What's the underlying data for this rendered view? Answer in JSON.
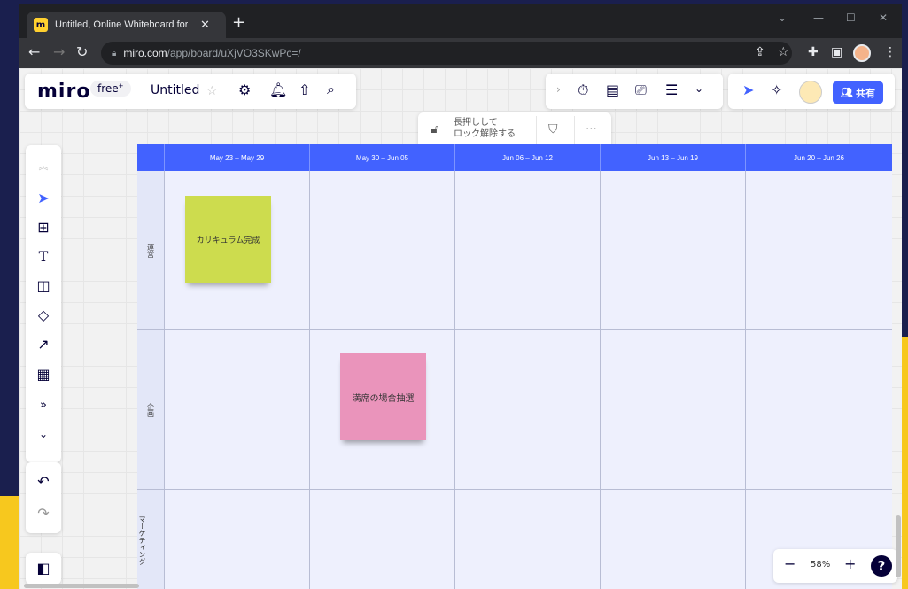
{
  "browser": {
    "tab_title": "Untitled, Online Whiteboard for Visual Collaboration",
    "url_host": "miro.com",
    "url_path": "/app/board/uXjVO3SKwPc=/"
  },
  "app": {
    "logo": "miro",
    "plan": "free",
    "plan_sup": "+",
    "board_name": "Untitled",
    "share_label": "共有",
    "lock_line1": "長押しして",
    "lock_line2": "ロック解除する",
    "zoom": "58%",
    "help": "?"
  },
  "board": {
    "columns": [
      "May 23 – May 29",
      "May 30 – Jun 05",
      "Jun 06 – Jun 12",
      "Jun 13 – Jun 19",
      "Jun 20 – Jun 26"
    ],
    "rows": [
      "運営",
      "企画",
      "マーケティング"
    ],
    "stickies": [
      {
        "text": "カリキュラム完成",
        "color": "#cddc4e"
      },
      {
        "text": "満席の場合抽選",
        "color": "#ea94bb"
      }
    ]
  },
  "colors": {
    "accent": "#4262ff",
    "sticky_yellow": "#cddc4e",
    "sticky_pink": "#ea94bb"
  }
}
